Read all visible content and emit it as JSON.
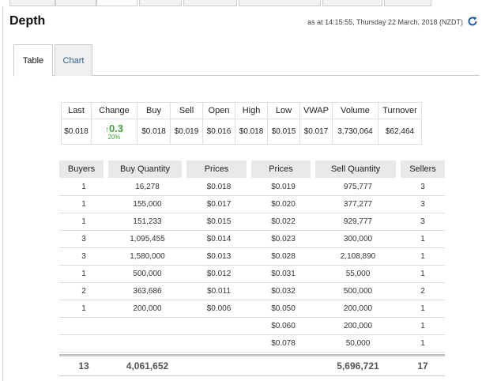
{
  "page_title": "Depth",
  "timestamp": "as at 14:15:55, Thursday 22 March, 2018 (NZDT)",
  "tabs": [
    {
      "label": "Table",
      "active": true
    },
    {
      "label": "Chart",
      "active": false
    }
  ],
  "summary": {
    "headers": [
      "Last",
      "Change",
      "Buy",
      "Sell",
      "Open",
      "High",
      "Low",
      "VWAP",
      "Volume",
      "Turnover"
    ],
    "last": "$0.018",
    "change_value": "0.3",
    "change_percent": "20%",
    "change_color": "#3aa53a",
    "buy": "$0.018",
    "sell": "$0.019",
    "open": "$0.016",
    "high": "$0.018",
    "low": "$0.015",
    "vwap": "$0.017",
    "volume": "3,730,064",
    "turnover": "$62,464"
  },
  "depth": {
    "headers": [
      "Buyers",
      "Buy Quantity",
      "Prices",
      "Prices",
      "Sell Quantity",
      "Sellers"
    ],
    "rows": [
      {
        "buyers": "1",
        "buy_qty": "16,278",
        "buy_price": "$0.018",
        "sell_price": "$0.019",
        "sell_qty": "975,777",
        "sellers": "3"
      },
      {
        "buyers": "1",
        "buy_qty": "155,000",
        "buy_price": "$0.017",
        "sell_price": "$0.020",
        "sell_qty": "377,277",
        "sellers": "3"
      },
      {
        "buyers": "1",
        "buy_qty": "151,233",
        "buy_price": "$0.015",
        "sell_price": "$0.022",
        "sell_qty": "929,777",
        "sellers": "3"
      },
      {
        "buyers": "3",
        "buy_qty": "1,095,455",
        "buy_price": "$0.014",
        "sell_price": "$0.023",
        "sell_qty": "300,000",
        "sellers": "1"
      },
      {
        "buyers": "3",
        "buy_qty": "1,580,000",
        "buy_price": "$0.013",
        "sell_price": "$0.028",
        "sell_qty": "2,108,890",
        "sellers": "1"
      },
      {
        "buyers": "1",
        "buy_qty": "500,000",
        "buy_price": "$0.012",
        "sell_price": "$0.031",
        "sell_qty": "55,000",
        "sellers": "1"
      },
      {
        "buyers": "2",
        "buy_qty": "363,686",
        "buy_price": "$0.011",
        "sell_price": "$0.032",
        "sell_qty": "500,000",
        "sellers": "2"
      },
      {
        "buyers": "1",
        "buy_qty": "200,000",
        "buy_price": "$0.006",
        "sell_price": "$0.050",
        "sell_qty": "200,000",
        "sellers": "1"
      },
      {
        "buyers": "",
        "buy_qty": "",
        "buy_price": "",
        "sell_price": "$0.060",
        "sell_qty": "200,000",
        "sellers": "1"
      },
      {
        "buyers": "",
        "buy_qty": "",
        "buy_price": "",
        "sell_price": "$0.078",
        "sell_qty": "50,000",
        "sellers": "1"
      }
    ],
    "totals": {
      "buyers": "13",
      "buy_qty": "4,061,652",
      "sell_qty": "5,696,721",
      "sellers": "17"
    }
  }
}
